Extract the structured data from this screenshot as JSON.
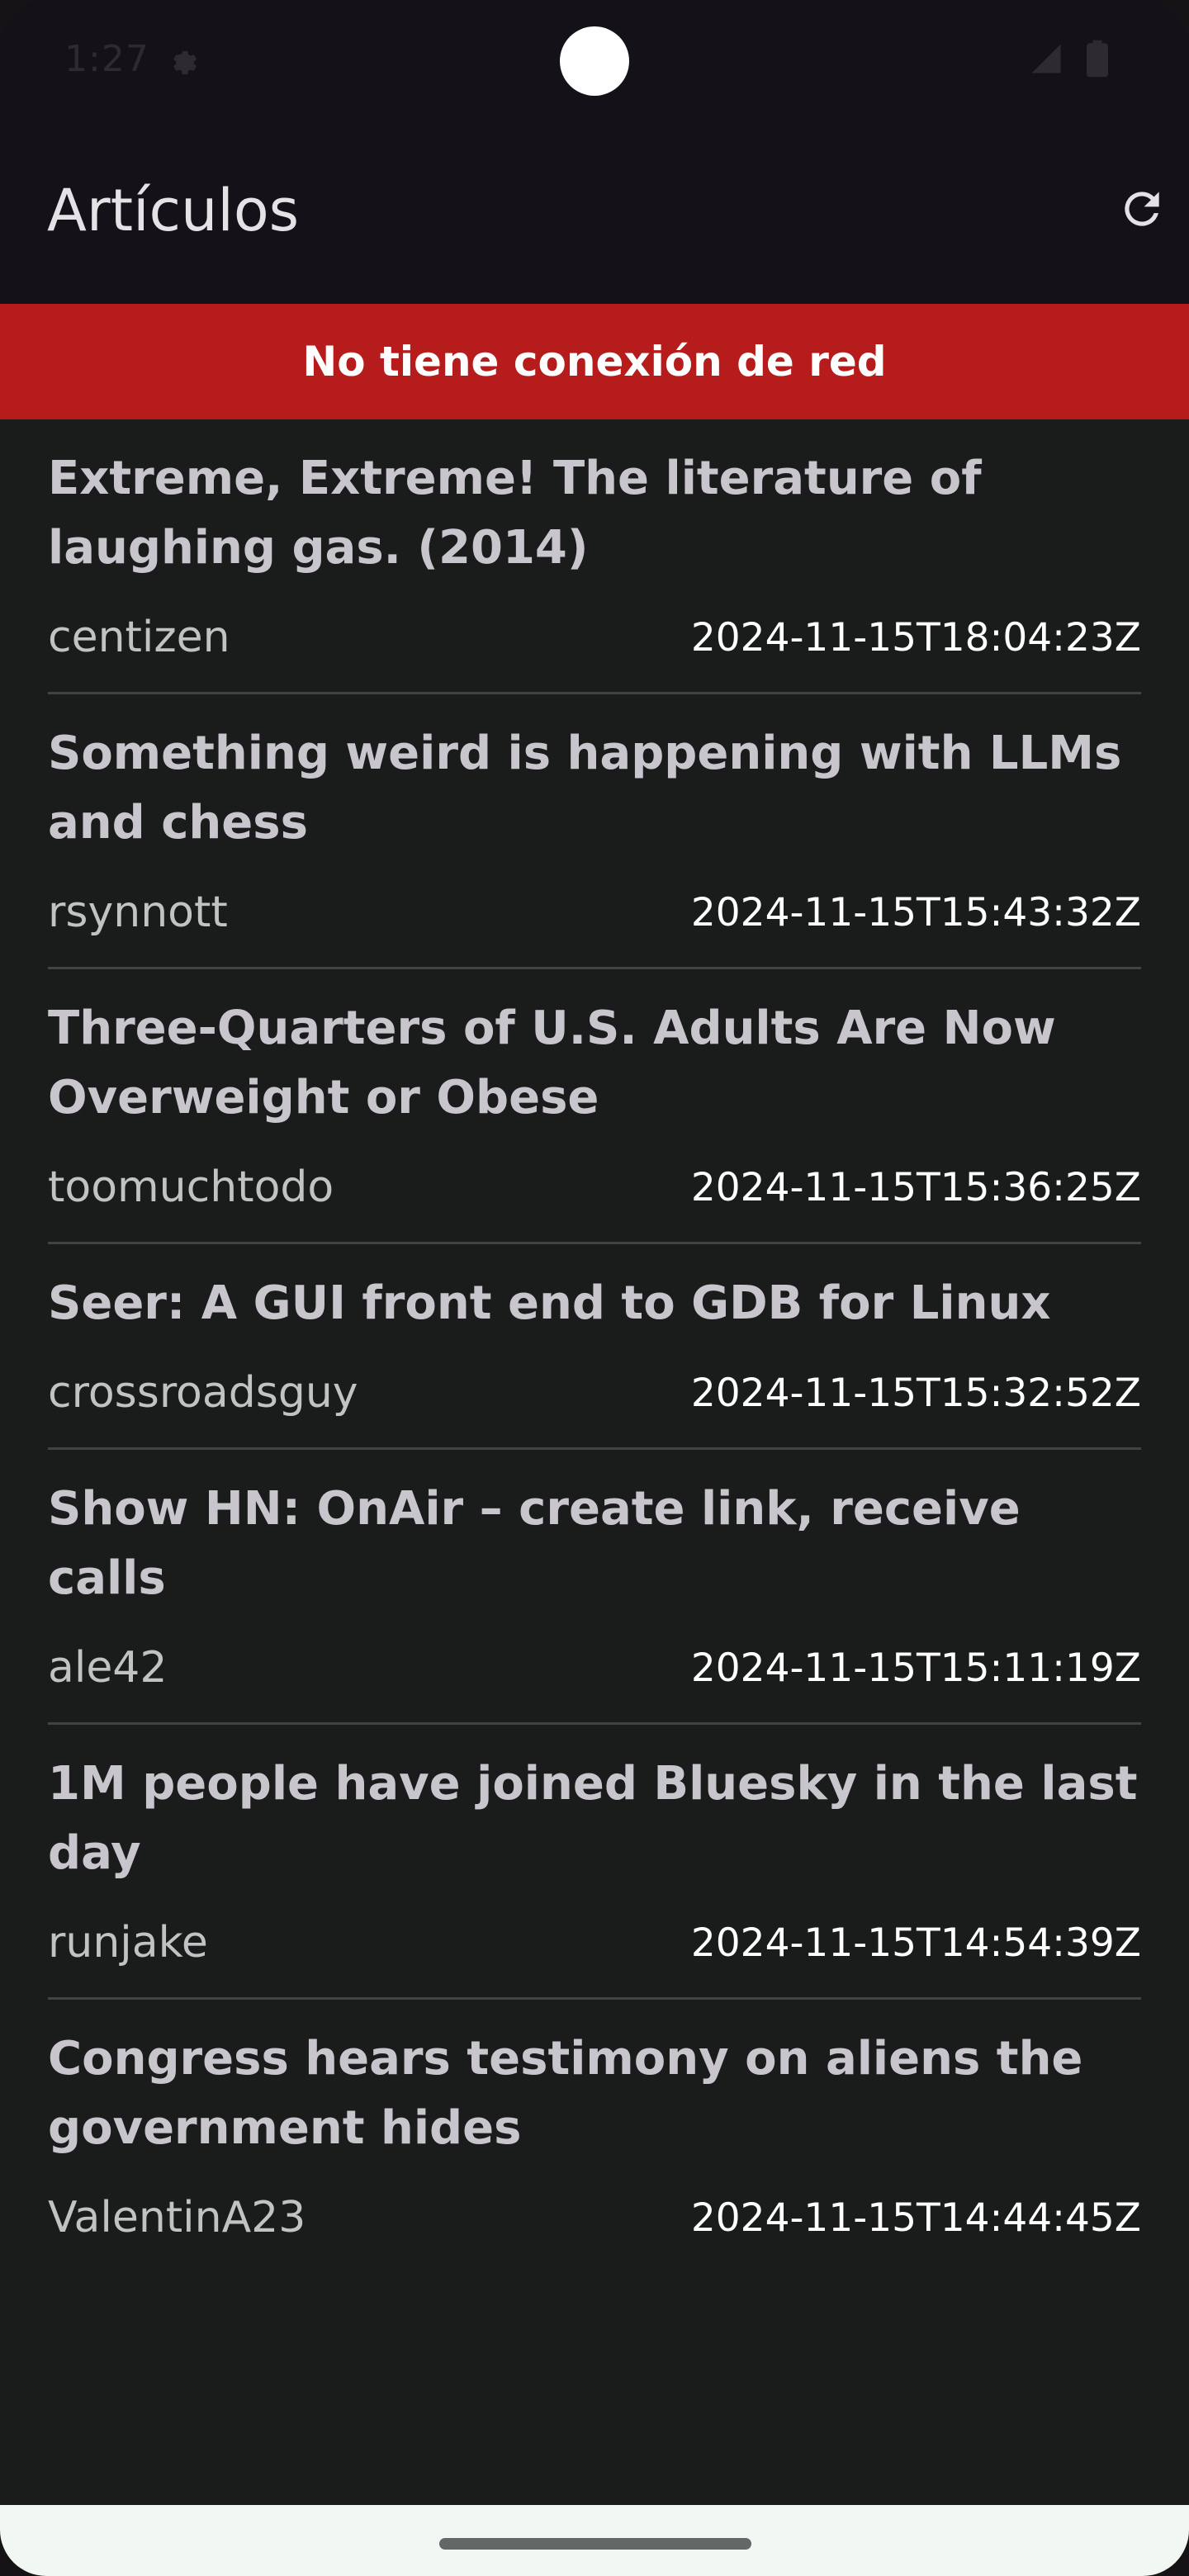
{
  "status_bar": {
    "time": "1:27",
    "icons": [
      "gear-icon",
      "signal-icon",
      "battery-icon"
    ]
  },
  "app_bar": {
    "title": "Artículos",
    "refresh_icon": "refresh-icon"
  },
  "banner": {
    "text": "No tiene conexión de red",
    "color": "#b71c1c"
  },
  "articles": [
    {
      "title": "Extreme, Extreme! The literature of laughing gas. (2014)",
      "author": "centizen",
      "date": "2024-11-15T18:04:23Z"
    },
    {
      "title": "Something weird is happening with LLMs and chess",
      "author": "rsynnott",
      "date": "2024-11-15T15:43:32Z"
    },
    {
      "title": "Three-Quarters of U.S. Adults Are Now Overweight or Obese",
      "author": "toomuchtodo",
      "date": "2024-11-15T15:36:25Z"
    },
    {
      "title": "Seer: A GUI front end to GDB for Linux",
      "author": "crossroadsguy",
      "date": "2024-11-15T15:32:52Z"
    },
    {
      "title": "Show HN: OnAir – create link, receive calls",
      "author": "ale42",
      "date": "2024-11-15T15:11:19Z"
    },
    {
      "title": "1M people have joined Bluesky in the last day",
      "author": "runjake",
      "date": "2024-11-15T14:54:39Z"
    },
    {
      "title": "Congress hears testimony on aliens the government hides",
      "author": "ValentinA23",
      "date": "2024-11-15T14:44:45Z"
    }
  ],
  "colors": {
    "background": "#1a1c1c",
    "app_bar": "#141218",
    "title_text": "#c9c5cd",
    "divider": "#3f4343"
  }
}
